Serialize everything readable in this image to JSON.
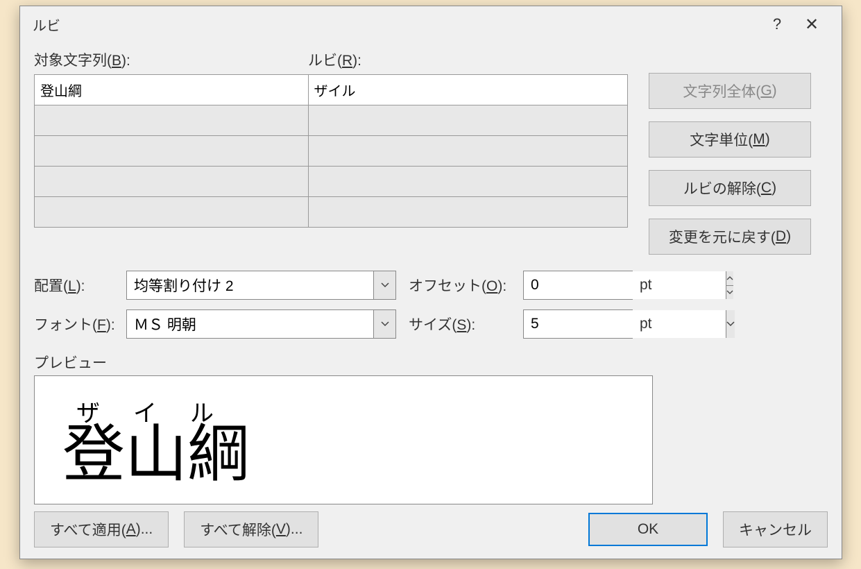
{
  "title": "ルビ",
  "headers": {
    "target_prefix": "対象文字列(",
    "target_key": "B",
    "target_suffix": "):",
    "ruby_prefix": "ルビ(",
    "ruby_key": "R",
    "ruby_suffix": "):"
  },
  "rows": [
    {
      "target": "登山綱",
      "ruby": "ザイル"
    },
    {
      "target": "",
      "ruby": ""
    },
    {
      "target": "",
      "ruby": ""
    },
    {
      "target": "",
      "ruby": ""
    },
    {
      "target": "",
      "ruby": ""
    }
  ],
  "side_buttons": {
    "whole_prefix": "文字列全体(",
    "whole_key": "G",
    "whole_suffix": ")",
    "per_char_prefix": "文字単位(",
    "per_char_key": "M",
    "per_char_suffix": ")",
    "clear_prefix": "ルビの解除(",
    "clear_key": "C",
    "clear_suffix": ")",
    "undo_prefix": "変更を元に戻す(",
    "undo_key": "D",
    "undo_suffix": ")"
  },
  "form": {
    "layout_prefix": "配置(",
    "layout_key": "L",
    "layout_suffix": "):",
    "layout_value": "均等割り付け 2",
    "offset_prefix": "オフセット(",
    "offset_key": "O",
    "offset_suffix": "):",
    "offset_value": "0",
    "font_prefix": "フォント(",
    "font_key": "F",
    "font_suffix": "):",
    "font_value": "ＭＳ 明朝",
    "size_prefix": "サイズ(",
    "size_key": "S",
    "size_suffix": "):",
    "size_value": "5",
    "unit": "pt"
  },
  "preview": {
    "label": "プレビュー",
    "ruby": "ザイル",
    "main": "登山綱"
  },
  "bottom": {
    "apply_all_prefix": "すべて適用(",
    "apply_all_key": "A",
    "apply_all_suffix": ")...",
    "remove_all_prefix": "すべて解除(",
    "remove_all_key": "V",
    "remove_all_suffix": ")...",
    "ok": "OK",
    "cancel": "キャンセル"
  }
}
